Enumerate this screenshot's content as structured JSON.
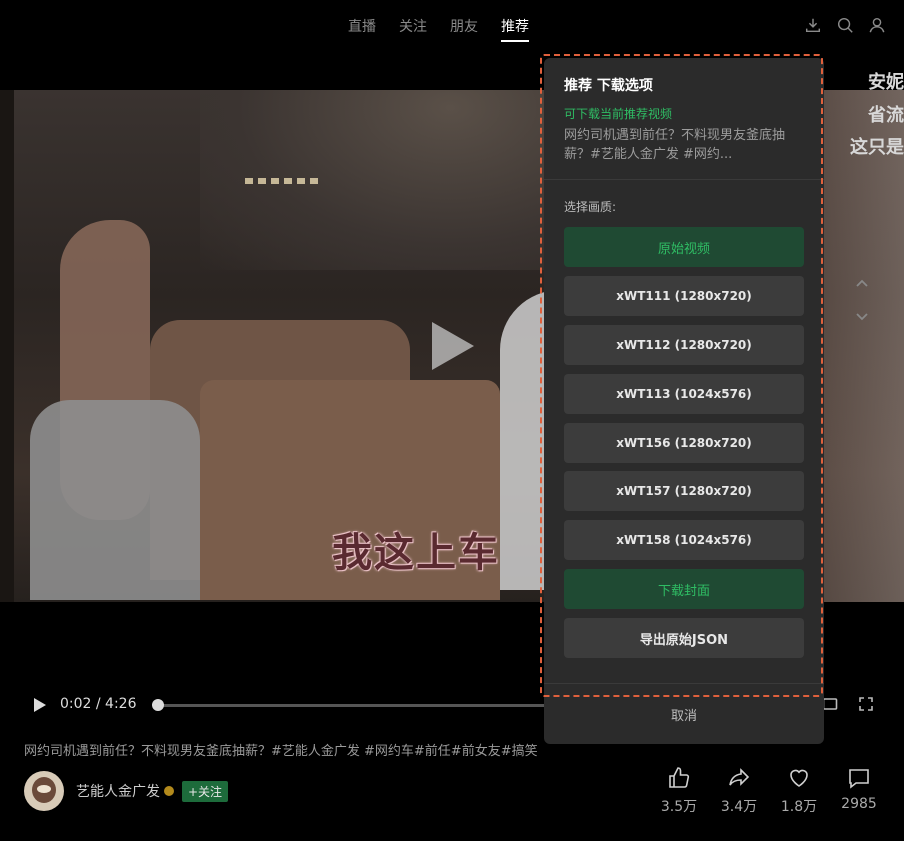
{
  "nav": {
    "tabs": [
      {
        "label": "直播"
      },
      {
        "label": "关注"
      },
      {
        "label": "朋友"
      },
      {
        "label": "推荐"
      }
    ],
    "active_tab": "推荐",
    "icons": [
      "download-icon",
      "search-icon",
      "user-icon"
    ]
  },
  "video": {
    "subtitle": "我这上车",
    "side_text": [
      "安妮",
      "省流",
      "这只是"
    ]
  },
  "player": {
    "time": "0:02 / 4:26",
    "progress": 0.008
  },
  "post": {
    "description": "网约司机遇到前任？不料现男友釜底抽薪？#艺能人金广发 #网约车#前任#前女友#搞笑",
    "author": "艺能人金广发",
    "follow_label": "+关注",
    "stats": {
      "likes": "3.5万",
      "shares": "3.4万",
      "favorites": "1.8万",
      "comments": "2985"
    }
  },
  "panel": {
    "title": "推荐 下载选项",
    "hint": "可下载当前推荐视频",
    "video_title": "网约司机遇到前任？不料现男友釜底抽薪？#艺能人金广发 #网约...",
    "quality_label": "选择画质:",
    "options": [
      "原始视频",
      "xWT111 (1280x720)",
      "xWT112 (1280x720)",
      "xWT113 (1024x576)",
      "xWT156 (1280x720)",
      "xWT157 (1280x720)",
      "xWT158 (1024x576)"
    ],
    "download_cover": "下载封面",
    "export_json": "导出原始JSON",
    "cancel": "取消",
    "accent": "#2fbd64",
    "outline_color": "#e0603c"
  }
}
